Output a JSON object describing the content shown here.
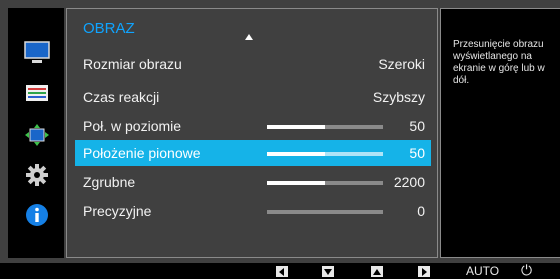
{
  "menu": {
    "title": "OBRAZ",
    "rows": [
      {
        "label": "Rozmiar obrazu",
        "value": "Szeroki"
      },
      {
        "label": "Czas reakcji",
        "value": "Szybszy"
      },
      {
        "label": "Poł. w poziomie",
        "value": "50",
        "level": 0.5
      },
      {
        "label": "Położenie pionowe",
        "value": "50",
        "level": 0.5,
        "selected": true
      },
      {
        "label": "Zgrubne",
        "value": "2200",
        "level": 0.5
      },
      {
        "label": "Precyzyjne",
        "value": "0",
        "level": 0
      }
    ]
  },
  "help": {
    "text": "Przesunięcie obrazu wyświetlanego na ekranie w górę lub w dół."
  },
  "bottombar": {
    "auto_label": "AUTO",
    "power_glyph": "⏻"
  },
  "sidebar": {
    "icons": [
      "monitor-picture-icon",
      "color-settings-icon",
      "size-position-icon",
      "setup-gear-icon",
      "information-icon"
    ]
  },
  "colors": {
    "accent": "#15b3e8",
    "title": "#0fa4ff"
  }
}
